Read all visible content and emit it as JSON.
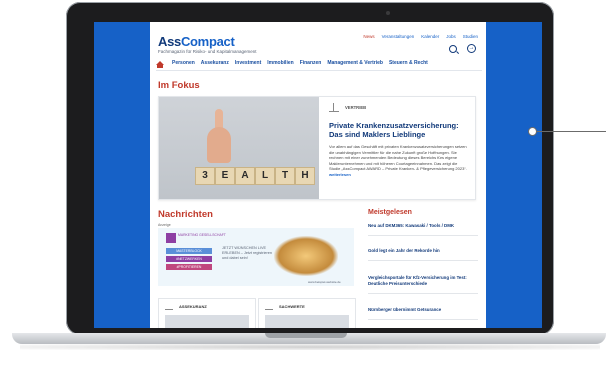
{
  "site": {
    "logo_ass": "Ass",
    "logo_compact": "Compact",
    "tagline": "Fachmagazin für Risiko- und Kapitalmanagement"
  },
  "toplinks": [
    "News",
    "Veranstaltungen",
    "Kalender",
    "Jobs",
    "Studien"
  ],
  "nav": [
    "Personen",
    "Assekuranz",
    "Investment",
    "Immobilien",
    "Finanzen",
    "Management & Vertrieb",
    "Steuern & Recht"
  ],
  "fokus": {
    "heading": "Im Fokus",
    "category": "VERTRIEB",
    "title": "Private Krankenzusatzversicherung: Das sind Maklers Lieblinge",
    "text": "Vor allem auf das Geschäft mit privaten Krankenzusatzversicherungen setzen die unabhängigen Vermittler für die nahe Zukunft große Hoffnungen. Sie rechnen mit einer zunehmenden Bedeutung dieses Bereichs fürs eigene Maklerunternehmen und mit höheren Courtageeinnahmen. Das zeigt die Studie „AssCompact AWARD – Private Kranken- & Pflegeversicherung 2023“.",
    "more": "weiterlesen",
    "image_letters": [
      "3",
      "E",
      "A",
      "L",
      "T",
      "H"
    ]
  },
  "nachrichten": {
    "heading": "Nachrichten",
    "ad_label": "Anzeige",
    "ad": {
      "brand": "MARKETING GESELLSCHAFT",
      "pills": [
        "MASTERBLOCK",
        "#NETZWERKEN",
        "#PROFITIEREN"
      ],
      "text": "JETZT WÜNSCHEN LIVE ERLEBEN – Jetzt registrieren und dabei sein!",
      "url": "www.beispiel-website.de",
      "pill_colors": [
        "#5a8fd8",
        "#8e3fa3",
        "#c0477e"
      ]
    },
    "boxes": [
      {
        "label": "ASSEKURANZ"
      },
      {
        "label": "SACHWERTE"
      }
    ]
  },
  "meistgelesen": {
    "heading": "Meistgelesen",
    "items": [
      "Neu auf DKM365: Kawasaki / Tools / DMK",
      "Gold legt ein Jahr der Rekorde hin",
      "Vergleichsportale für Kfz-Versicherung im Test: Deutliche Preisunterschiede",
      "Nürnberger übernimmt Getsurance"
    ]
  },
  "colors": {
    "brand_blue": "#1661c7",
    "accent_red": "#c0392b",
    "navy": "#123a7a"
  }
}
